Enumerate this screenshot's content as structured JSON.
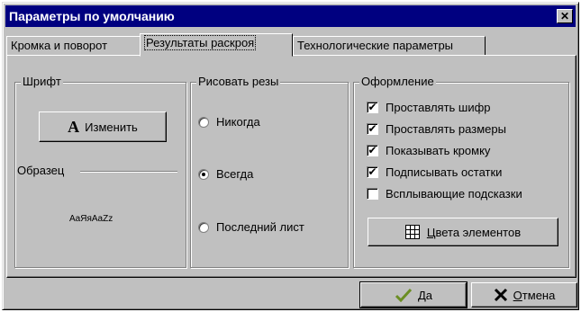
{
  "window": {
    "title": "Параметры по умолчанию",
    "close_glyph": "✕"
  },
  "tabs": [
    {
      "label": "Кромка и поворот",
      "active": false
    },
    {
      "label": "Результаты раскроя",
      "active": true
    },
    {
      "label": "Технологические параметры",
      "active": false
    }
  ],
  "font_group": {
    "legend": "Шрифт",
    "change_button_glyph": "A",
    "change_button_label": "Изменить",
    "sample_label": "Образец",
    "sample_text": "AaЯяAaZz"
  },
  "cuts_group": {
    "legend": "Рисовать резы",
    "options": [
      {
        "label": "Никогда",
        "selected": false
      },
      {
        "label": "Всегда",
        "selected": true
      },
      {
        "label": "Последний лист",
        "selected": false
      }
    ]
  },
  "design_group": {
    "legend": "Оформление",
    "checkboxes": [
      {
        "label": "Проставлять шифр",
        "checked": true
      },
      {
        "label": "Проставлять размеры",
        "checked": true
      },
      {
        "label": "Показывать кромку",
        "checked": true
      },
      {
        "label": "Подписывать остатки",
        "checked": true
      },
      {
        "label": "Всплывающие подсказки",
        "checked": false
      }
    ],
    "colors_button": {
      "hotkey": "Ц",
      "rest": "вета элементов"
    }
  },
  "footer": {
    "ok": {
      "hotkey": "Д",
      "rest": "а"
    },
    "cancel": {
      "hotkey": "О",
      "rest": "тмена"
    }
  },
  "colors": {
    "face": "#c0c0c0",
    "titlebar": "#000080",
    "ok_check": "#6b8e23",
    "cancel_x": "#000000"
  }
}
